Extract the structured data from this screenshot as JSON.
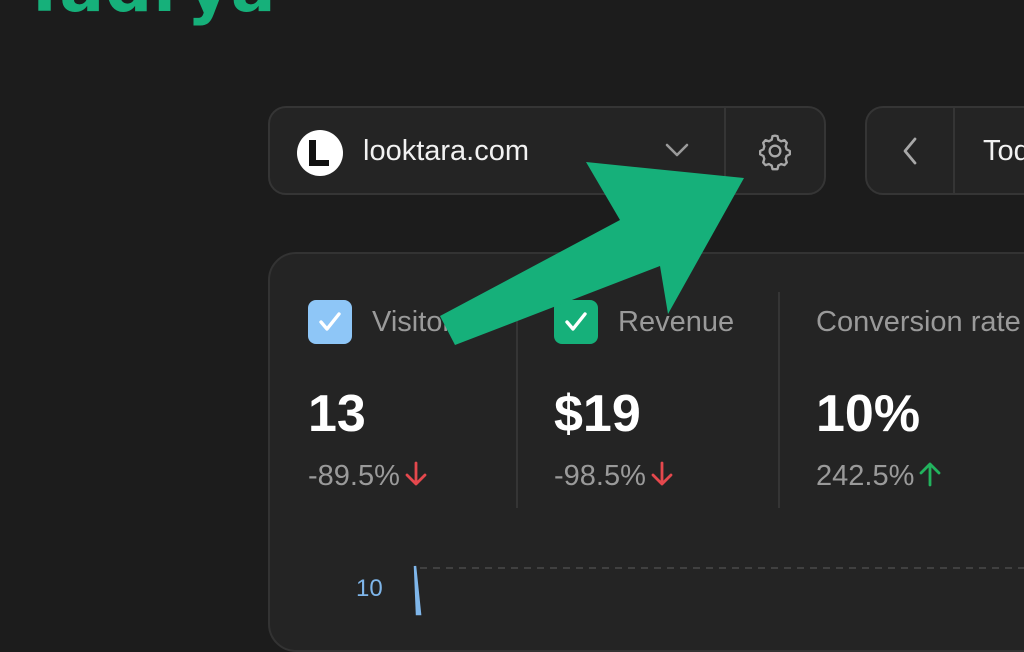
{
  "brand": {
    "name": "Tadrya"
  },
  "site_selector": {
    "domain": "looktara.com"
  },
  "date_nav": {
    "current": "Today"
  },
  "metrics": [
    {
      "label": "Visitors",
      "value": "13",
      "change": "-89.5%",
      "trend": "down",
      "checked": true,
      "check_color": "#8ec6f7"
    },
    {
      "label": "Revenue",
      "value": "$19",
      "change": "-98.5%",
      "trend": "down",
      "checked": true,
      "check_color": "#16b07a"
    },
    {
      "label": "Conversion rate",
      "value": "10%",
      "change": "242.5%",
      "trend": "up",
      "checked": false
    }
  ],
  "chart": {
    "y_tick": "10"
  },
  "colors": {
    "accent": "#16b07a",
    "down": "#e5484d",
    "up": "#22b35e",
    "visitors_series": "#7fb6ea"
  }
}
